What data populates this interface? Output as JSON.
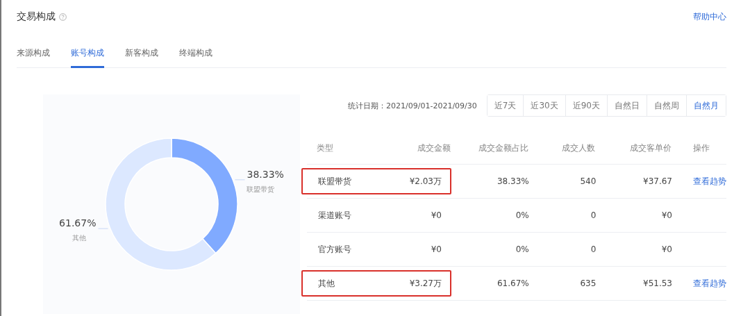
{
  "header": {
    "title": "交易构成",
    "help_link": "帮助中心"
  },
  "tabs": [
    {
      "label": "来源构成",
      "selected": false
    },
    {
      "label": "账号构成",
      "selected": true
    },
    {
      "label": "新客构成",
      "selected": false
    },
    {
      "label": "终端构成",
      "selected": false
    }
  ],
  "chart": {
    "chart_data": {
      "type": "donut",
      "categories": [
        "联盟带货",
        "其他"
      ],
      "values": [
        38.33,
        61.67
      ],
      "colors": [
        "#80aaff",
        "#dce8ff"
      ],
      "value_labels": [
        "38.33%",
        "61.67%"
      ]
    }
  },
  "date_range": "统计日期：2021/09/01-2021/09/30",
  "periods": [
    {
      "label": "近7天",
      "selected": false
    },
    {
      "label": "近30天",
      "selected": false
    },
    {
      "label": "近90天",
      "selected": false
    },
    {
      "label": "自然日",
      "selected": false
    },
    {
      "label": "自然周",
      "selected": false
    },
    {
      "label": "自然月",
      "selected": true
    }
  ],
  "table": {
    "columns": [
      "类型",
      "成交金额",
      "成交金额占比",
      "成交人数",
      "成交客单价",
      "操作"
    ],
    "rows": [
      {
        "type": "联盟带货",
        "amount": "¥2.03万",
        "share": "38.33%",
        "buyers": "540",
        "avg_price": "¥37.67",
        "action": "查看趋势",
        "highlighted": true
      },
      {
        "type": "渠道账号",
        "amount": "¥0",
        "share": "0%",
        "buyers": "0",
        "avg_price": "¥0",
        "highlighted": false
      },
      {
        "type": "官方账号",
        "amount": "¥0",
        "share": "0%",
        "buyers": "0",
        "avg_price": "¥0",
        "highlighted": false
      },
      {
        "type": "其他",
        "amount": "¥3.27万",
        "share": "61.67%",
        "buyers": "635",
        "avg_price": "¥51.53",
        "action": "查看趋势",
        "highlighted": true
      }
    ]
  }
}
